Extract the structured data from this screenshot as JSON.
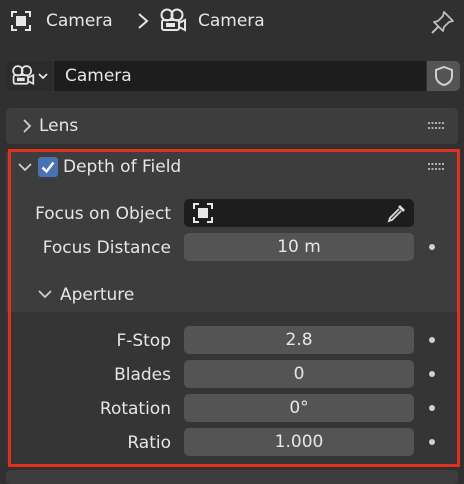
{
  "header": {
    "breadcrumb_object": "Camera",
    "breadcrumb_data": "Camera",
    "icons": [
      "object-icon",
      "chevron-right-icon",
      "camera-data-icon",
      "pin-icon"
    ]
  },
  "datablock": {
    "name": "Camera",
    "icons": [
      "camera-data-icon",
      "chevron-down-icon",
      "shield-icon"
    ]
  },
  "panels": {
    "lens": {
      "label": "Lens",
      "expanded": false
    },
    "dof": {
      "label": "Depth of Field",
      "enabled": true,
      "expanded": true,
      "focus_object_label": "Focus on Object",
      "focus_object_value": "",
      "focus_distance_label": "Focus Distance",
      "focus_distance_value": "10 m",
      "aperture": {
        "label": "Aperture",
        "expanded": true,
        "fstop_label": "F-Stop",
        "fstop_value": "2.8",
        "blades_label": "Blades",
        "blades_value": "0",
        "rotation_label": "Rotation",
        "rotation_value": "0°",
        "ratio_label": "Ratio",
        "ratio_value": "1.000"
      }
    }
  },
  "colors": {
    "highlight": "#e0301e",
    "checkbox": "#4772b3",
    "background": "#303030",
    "panel": "#3d3d3d",
    "field": "#545454"
  }
}
